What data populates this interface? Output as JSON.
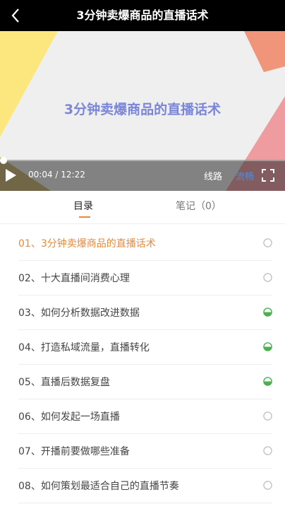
{
  "header": {
    "title": "3分钟卖爆商品的直播话术"
  },
  "player": {
    "slide_title": "3分钟卖爆商品的直播话术",
    "current_time": "00:04",
    "total_time": "12:22",
    "time_display": "00:04 / 12:22",
    "progress": 0.0054,
    "line_label": "线路",
    "quality_label": "流畅",
    "colors": {
      "quality": "#4a90e2",
      "slide_title": "#7b86d9"
    }
  },
  "tabs": {
    "catalog": "目录",
    "notes": "笔记（0）",
    "accent": "#e8893a"
  },
  "lessons": [
    {
      "label": "01、3分钟卖爆商品的直播话术",
      "status": "not-started",
      "active": true
    },
    {
      "label": "02、十大直播间消费心理",
      "status": "not-started"
    },
    {
      "label": "03、如何分析数据改进数据",
      "status": "in-progress"
    },
    {
      "label": "04、打造私域流量，直播转化",
      "status": "in-progress"
    },
    {
      "label": "05、直播后数据复盘",
      "status": "in-progress"
    },
    {
      "label": "06、如何发起一场直播",
      "status": "not-started"
    },
    {
      "label": "07、开播前要做哪些准备",
      "status": "not-started"
    },
    {
      "label": "08、如何策划最适合自己的直播节奏",
      "status": "not-started"
    }
  ]
}
